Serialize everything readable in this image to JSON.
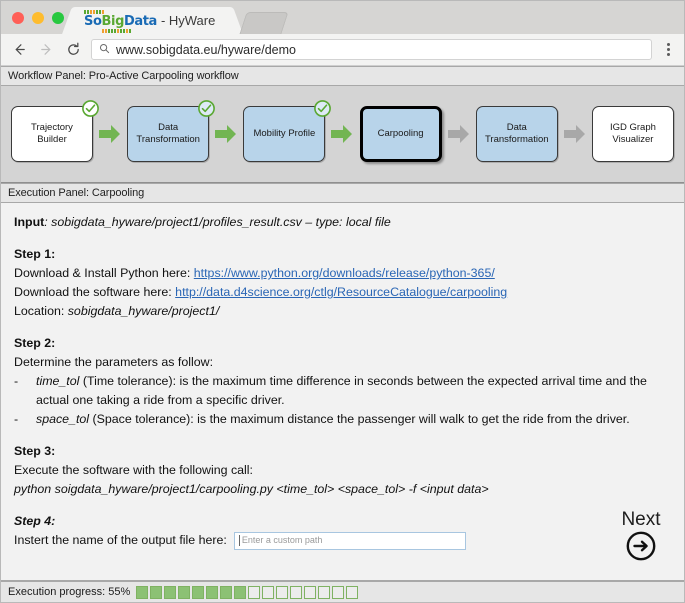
{
  "browser": {
    "tab": {
      "logo_so": "So",
      "logo_big": "Big",
      "logo_data": "Data",
      "title": "- HyWare"
    },
    "nav": {
      "back_icon": "back-arrow-icon",
      "forward_icon": "forward-arrow-icon",
      "reload_icon": "reload-icon",
      "menu_icon": "kebab-menu-icon"
    },
    "omnibox": {
      "search_icon": "search-icon",
      "url": "www.sobigdata.eu/hyware/demo"
    }
  },
  "workflow_panel": {
    "header": "Workflow Panel: Pro-Active Carpooling workflow",
    "nodes": [
      {
        "label": "Trajectory Builder",
        "state": "done",
        "fill": "white",
        "checked": true
      },
      {
        "label": "Data Transformation",
        "state": "done",
        "fill": "blue",
        "checked": true
      },
      {
        "label": "Mobility Profile",
        "state": "done",
        "fill": "blue",
        "checked": true
      },
      {
        "label": "Carpooling",
        "state": "active",
        "fill": "blue",
        "checked": false
      },
      {
        "label": "Data Transformation",
        "state": "pending",
        "fill": "blue",
        "checked": false
      },
      {
        "label": "IGD Graph Visualizer",
        "state": "pending",
        "fill": "white",
        "checked": false
      }
    ],
    "arrows": [
      {
        "color": "#72b552"
      },
      {
        "color": "#72b552"
      },
      {
        "color": "#72b552"
      },
      {
        "color": "#a8a8a8"
      },
      {
        "color": "#a8a8a8"
      }
    ]
  },
  "execution_panel": {
    "header": "Execution Panel: Carpooling",
    "input_label": "Input",
    "input_value": ": sobigdata_hyware/project1/profiles_result.csv – type: local file",
    "step1": {
      "title": "Step 1:",
      "line1_pre": "Download & Install Python here: ",
      "line1_link": "https://www.python.org/downloads/release/python-365/",
      "line2_pre": "Download the software here: ",
      "line2_link": "http://data.d4science.org/ctlg/ResourceCatalogue/carpooling",
      "line3_pre": "Location: ",
      "line3_em": "sobigdata_hyware/project1/"
    },
    "step2": {
      "title": "Step 2:",
      "intro": "Determine the parameters as follow:",
      "bullets": [
        {
          "dash": "-",
          "term": "time_tol",
          "text": " (Time tolerance): is the maximum time difference in seconds between the expected arrival time and the actual one taking a ride from a specific driver."
        },
        {
          "dash": "-",
          "term": "space_tol",
          "text": " (Space tolerance): is the maximum distance the passenger will walk to get the ride from the driver."
        }
      ]
    },
    "step3": {
      "title": "Step 3:",
      "intro": "Execute the software with the following call:",
      "command": "python soigdata_hyware/project1/carpooling.py <time_tol> <space_tol> -f <input data>"
    },
    "step4": {
      "title": "Step 4:",
      "label": "Instert the name of the output file here:",
      "input_value": "",
      "input_placeholder": "Enter a custom path"
    },
    "next": {
      "label": "Next",
      "icon": "arrow-right-circle-icon"
    }
  },
  "statusbar": {
    "label": "Execution progress: 55%",
    "percent": 55,
    "blocks_total": 16,
    "blocks_filled": 8
  },
  "colors": {
    "node_blue": "#b8d4ea",
    "arrow_green": "#72b552",
    "arrow_grey": "#a8a8a8",
    "check_green": "#5aa832",
    "link_blue": "#2a66b5",
    "progress_green": "#8cc174"
  }
}
